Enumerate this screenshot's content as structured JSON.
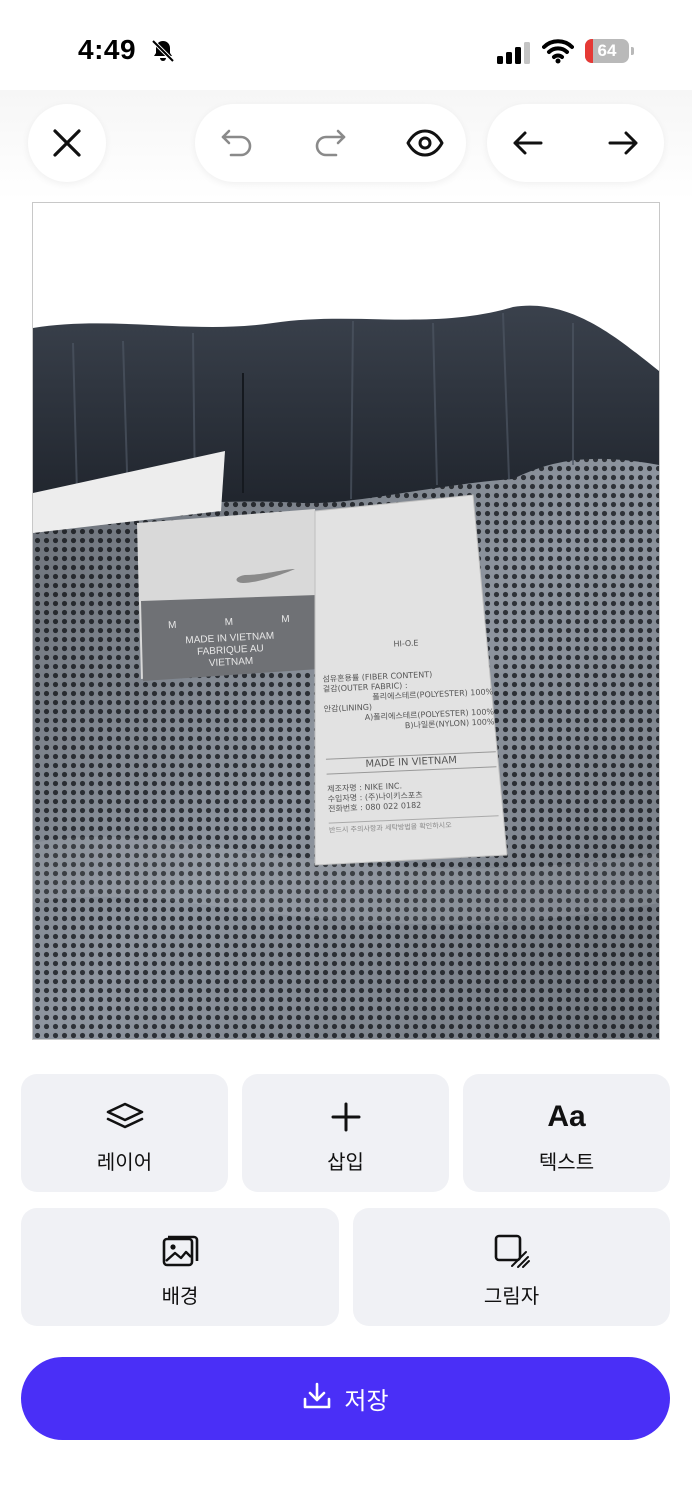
{
  "status_bar": {
    "time": "4:49",
    "battery_level": "64",
    "battery_low_color": "#e53935",
    "icons": [
      "bell-muted-icon",
      "signal-icon",
      "wifi-icon",
      "battery-icon"
    ]
  },
  "toolbar": {
    "icons": [
      "close-icon",
      "undo-icon",
      "redo-icon",
      "eye-icon",
      "arrow-left-icon",
      "arrow-right-icon"
    ]
  },
  "canvas": {
    "photo_description_icon": "photo-image",
    "brand_label": {
      "sizes": [
        "M",
        "M",
        "M"
      ],
      "lines": [
        "MADE IN VIETNAM",
        "FABRIQUE AU",
        "VIETNAM"
      ]
    },
    "care_label": {
      "header": "HI-O.E",
      "lines": [
        "섬유혼용률 (FIBER CONTENT)",
        "겉감(OUTER FABRIC) :",
        "폴리에스테르(POLYESTER) 100%",
        "안감(LINING)",
        "A)폴리에스테르(POLYESTER) 100%",
        "B)나일론(NYLON) 100%"
      ],
      "origin": "MADE IN VIETNAM",
      "info": [
        "제조자명 : NIKE INC.",
        "수입자명 : (주)나이키스포츠",
        "전화번호 : 080 022 0182"
      ],
      "footer": "반드시 주의사항과 세탁방법을 확인하시오"
    }
  },
  "actions": {
    "layer": {
      "label": "레이어",
      "icon": "layers-icon"
    },
    "insert": {
      "label": "삽입",
      "icon": "plus-icon"
    },
    "text": {
      "label": "텍스트",
      "glyph": "Aa"
    },
    "background": {
      "label": "배경",
      "icon": "image-icon"
    },
    "shadow": {
      "label": "그림자",
      "icon": "shadow-icon"
    }
  },
  "save": {
    "label": "저장",
    "icon": "download-icon",
    "color": "#4a2ff7"
  }
}
